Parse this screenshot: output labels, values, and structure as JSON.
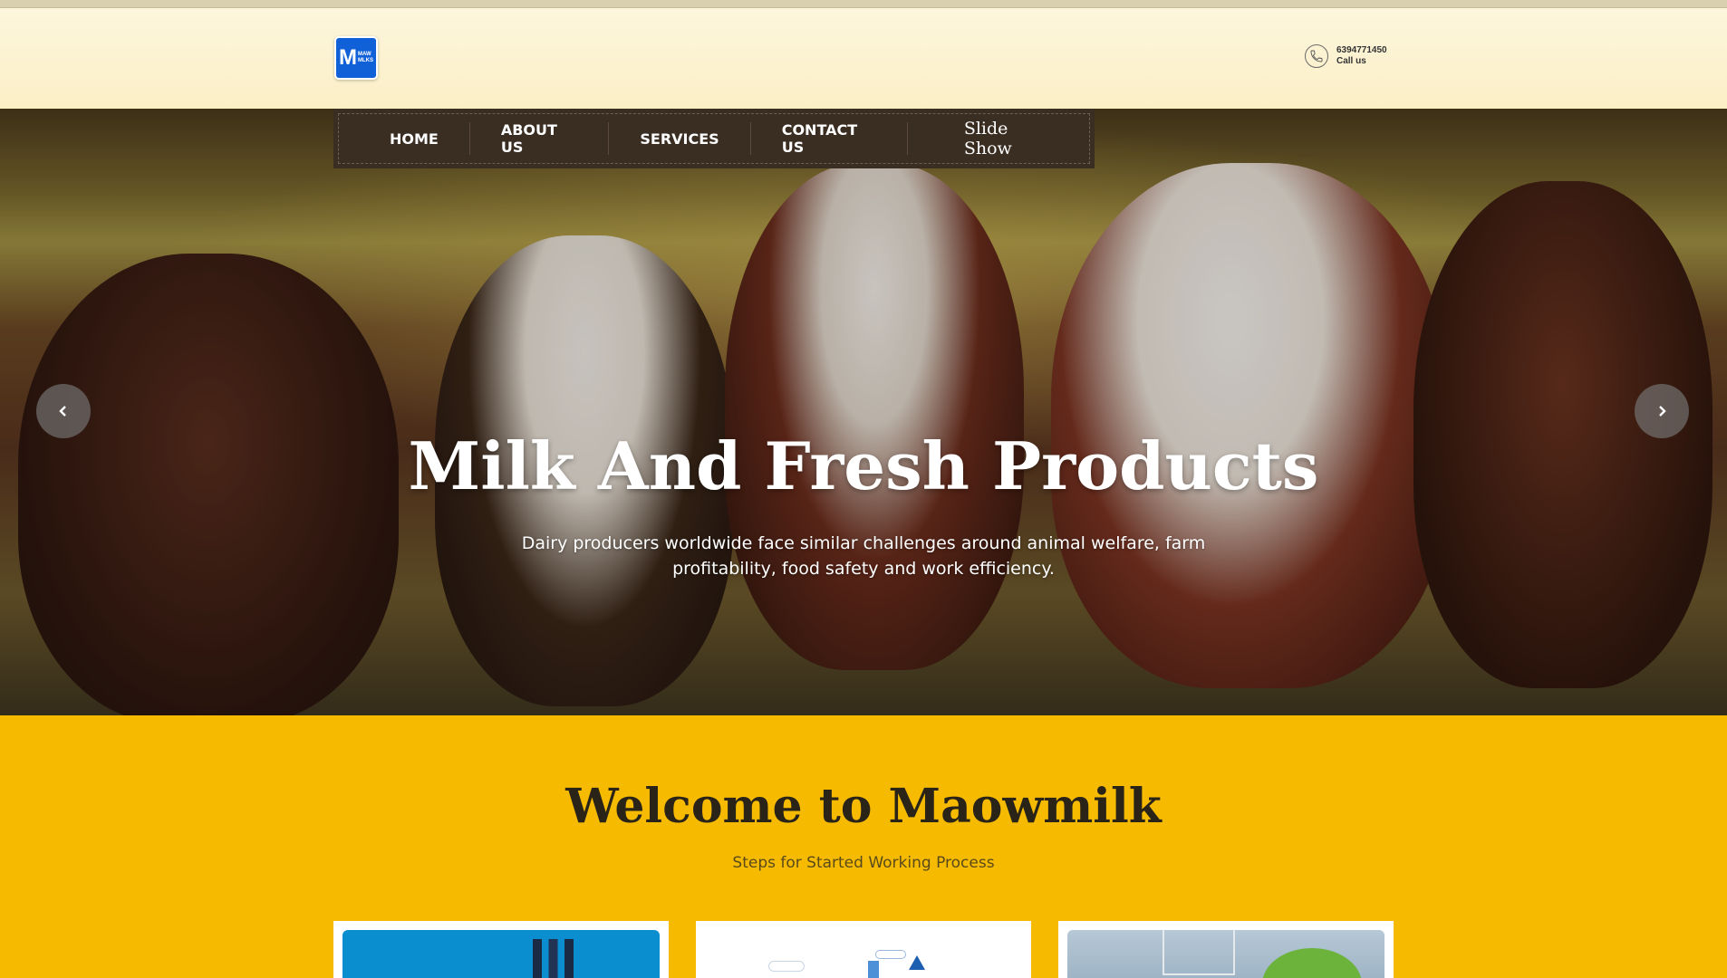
{
  "header": {
    "logo_letter": "M",
    "logo_small_top": "MAW",
    "logo_small_bottom": "MLKS",
    "phone": "6394771450",
    "call_label": "Call us"
  },
  "nav": {
    "items": [
      "HOME",
      "ABOUT US",
      "SERVICES",
      "CONTACT US"
    ],
    "slideshow": "Slide Show"
  },
  "hero": {
    "title": "Milk And Fresh Products",
    "subtitle": "Dairy producers worldwide face similar challenges around animal welfare, farm profitability, food safety and work efficiency."
  },
  "welcome": {
    "title": "Welcome to Maowmilk",
    "subtitle": "Steps for Started Working Process"
  },
  "colors": {
    "accent": "#f6bb00",
    "nav_bg": "#3a2d22",
    "logo_blue": "#1060d8"
  },
  "icons": [
    "phone-icon",
    "chevron-left-icon",
    "chevron-right-icon"
  ]
}
